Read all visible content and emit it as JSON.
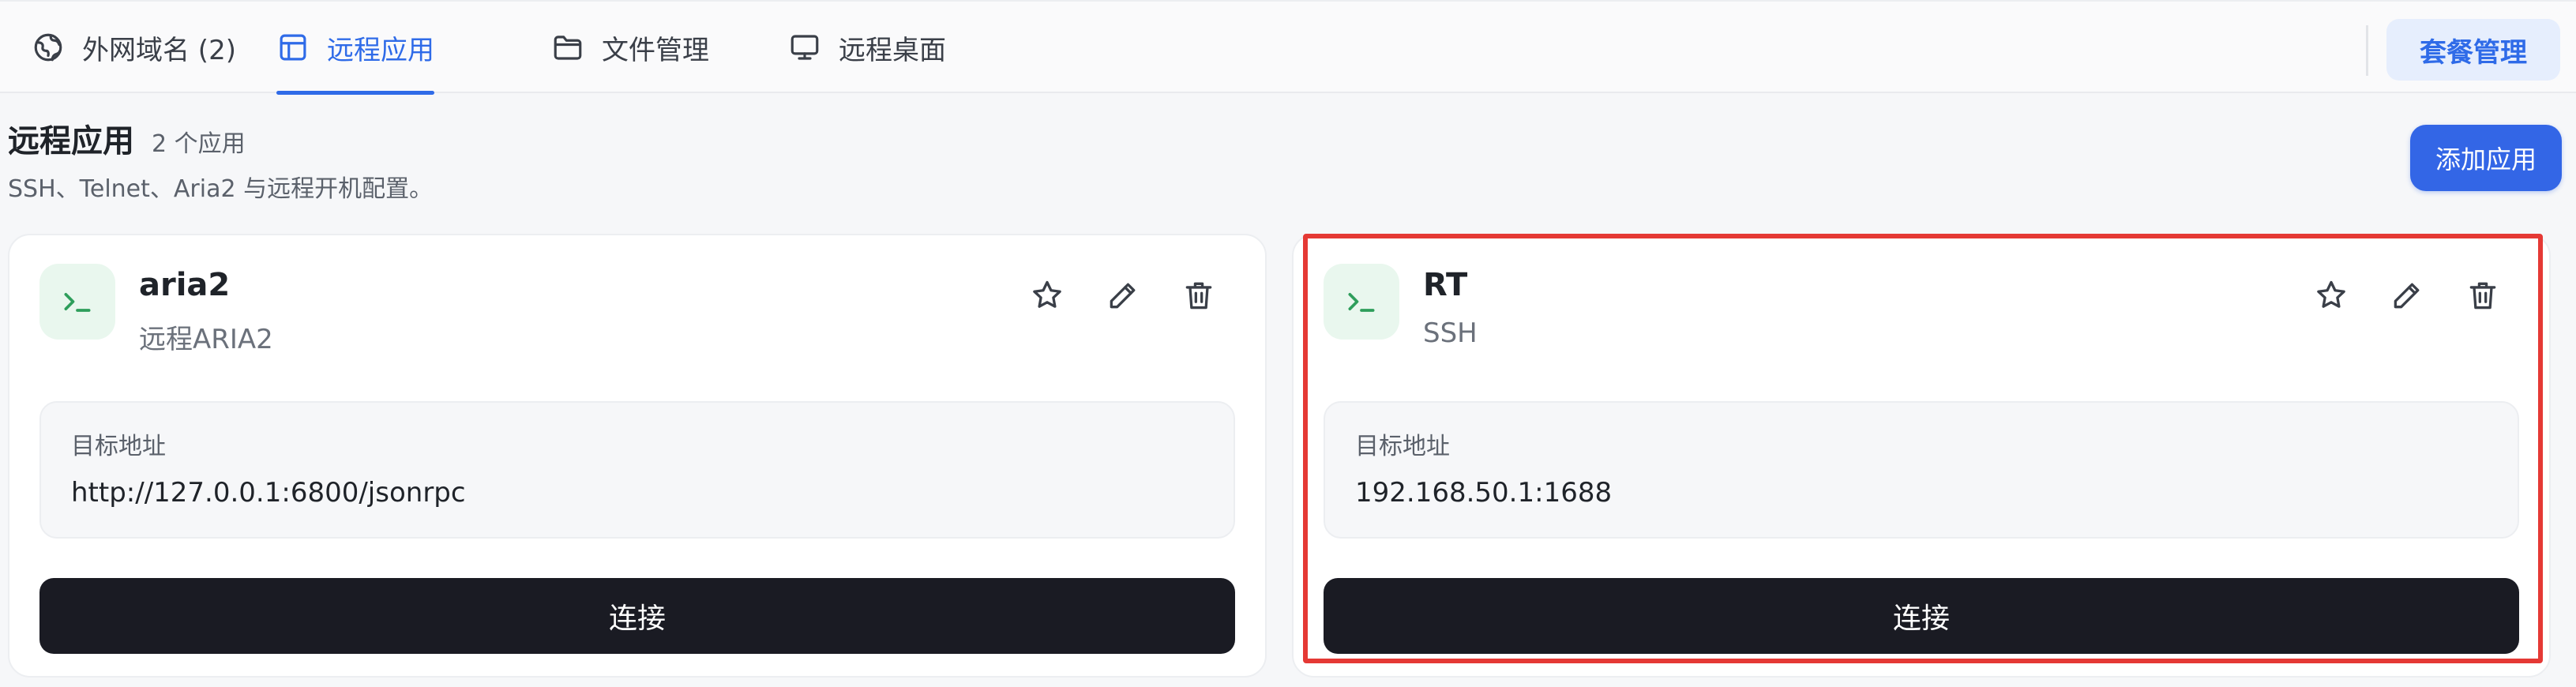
{
  "tabs": [
    {
      "label": "外网域名 (2)",
      "icon": "globe-icon",
      "active": false
    },
    {
      "label": "远程应用",
      "icon": "layout-icon",
      "active": true
    },
    {
      "label": "文件管理",
      "icon": "folder-icon",
      "active": false
    },
    {
      "label": "远程桌面",
      "icon": "monitor-icon",
      "active": false
    }
  ],
  "plan_button": "套餐管理",
  "section": {
    "title": "远程应用",
    "count": "2 个应用",
    "description": "SSH、Telnet、Aria2 与远程开机配置。",
    "add_button": "添加应用"
  },
  "apps": [
    {
      "name": "aria2",
      "type": "远程ARIA2",
      "address_label": "目标地址",
      "address": "http://127.0.0.1:6800/jsonrpc",
      "connect_label": "连接",
      "icon": "terminal-icon"
    },
    {
      "name": "RT",
      "type": "SSH",
      "address_label": "目标地址",
      "address": "192.168.50.1:1688",
      "connect_label": "连接",
      "icon": "terminal-icon"
    }
  ],
  "colors": {
    "accent": "#2f6be8",
    "primary_button": "#3366e6",
    "connect_button": "#1a1b23",
    "icon_bg": "#e9f7ee",
    "icon_fg": "#2e9e5b",
    "highlight": "#e53935"
  }
}
